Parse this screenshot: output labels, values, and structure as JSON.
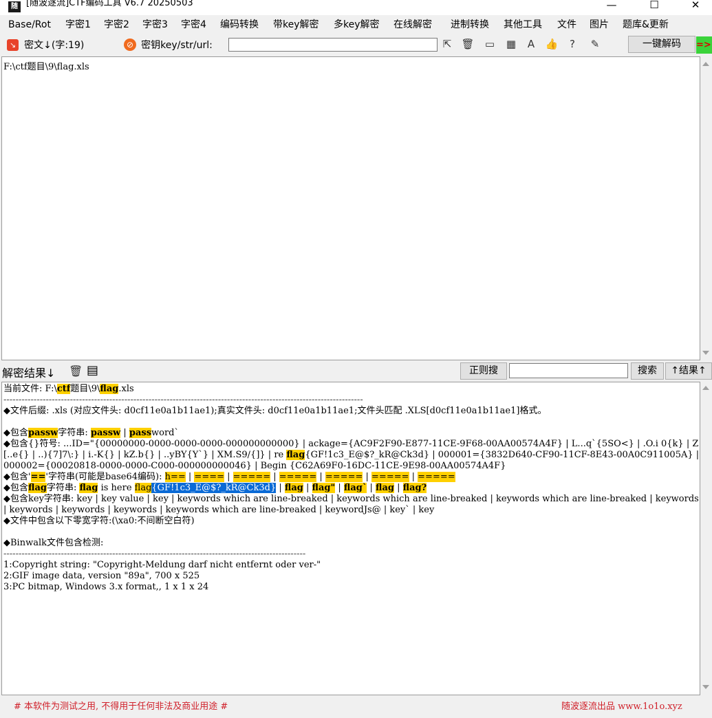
{
  "window": {
    "title": "[随波逐流]CTF编码工具 V6.7  20250503",
    "minimize": "—",
    "maximize": "☐",
    "close": "✕"
  },
  "menu": [
    "Base/Rot",
    "字密1",
    "字密2",
    "字密3",
    "字密4",
    "编码转换",
    "带key解密",
    "多key解密",
    "在线解密",
    "进制转换",
    "其他工具",
    "文件",
    "图片",
    "题库&更新"
  ],
  "toolbar": {
    "cipher_label": "密文↓(字:19)",
    "key_label": "密钥key/str/url:",
    "key_value": "",
    "one_click_label": "一键解码",
    "green_tab": "=>",
    "icons": [
      "cursor-icon",
      "trash-icon",
      "terminal-icon",
      "calculator-icon",
      "font-icon",
      "thumbs-up-icon",
      "help-icon",
      "edit-icon"
    ]
  },
  "cipher": {
    "text": "F:\\ctf题目\\9\\flag.xls"
  },
  "result_bar": {
    "label": "解密结果↓",
    "regex_button": "正则搜",
    "search_value": "",
    "search_button": "搜索",
    "result_up_button": "↑结果↑"
  },
  "result": {
    "file_prefix": "当前文件: F:\\",
    "file_ctf": "ctf",
    "file_mid": "题目\\9\\",
    "file_flag": "flag",
    "file_ext": ".xls",
    "separator": "-----------------------------------------------------------------------------------------------------------------------",
    "suffix_line": "◆文件后缀: .xls (对应文件头: d0cf11e0a1b11ae1);真实文件头: d0cf11e0a1b11ae1;文件头匹配 .XLS[d0cf11e0a1b11ae1]格式。",
    "passw_label_a": "◆包含",
    "passw_label_b": "passw",
    "passw_label_c": "字符串: ",
    "passw_v1a": "passw",
    "passw_sep": " | ",
    "passw_v2a": "pass",
    "passw_v2b": "word`",
    "brace_text_a": "◆包含{}符号: ...ID=\"{00000000-0000-0000-0000-000000000000} | ackage={AC9F2F90-E877-11CE-9F68-00AA00574A4F} | L...q`{5SO<} | .O.i 0{k} | Z[..e{} | ..){7]7\\:} | i.-K{} | kZ.b{} | ..yBY{Y`} | XM.S9/{]} | re ",
    "brace_flag": "flag",
    "brace_text_b": "{GF!1c3_E@$?_kR@Ck3d} | 000001={3832D640-CF90-11CF-8E43-00A0C911005A} | 000002={00020818-0000-0000-C000-000000000046} | Begin {C62A69F0-16DC-11CE-9E98-00AA00574A4F}",
    "eq_label": "◆包含'",
    "eq_mark": "==",
    "eq_label_b": "'字符串(可能是base64编码): ",
    "eq_items": [
      "h==",
      "====",
      "=====",
      "=====",
      "=====",
      "=====",
      "====="
    ],
    "flag_label_a": "◆包含",
    "flag_label_b": "flag",
    "flag_label_c": "字符串: ",
    "flag_v1": "flag",
    "flag_v1_rest": " is here ",
    "flag_sel_a": "flag",
    "flag_sel_b": "{GF!1c3_E@$?_kR@Ck3d}",
    "flag_items": [
      "flag",
      "flag\"",
      "flag`",
      "flag",
      "flag?"
    ],
    "key_text": "◆包含key字符串: key | key value | key | keywords which are line-breaked | keywords which are line-breaked | keywords which are line-breaked | keywords | keywords | keywords | keywords | keywords which are line-breaked | keywordJs@ | key` | key",
    "zero_width": "◆文件中包含以下零宽字符:(\\xa0:不间断空白符)",
    "binwalk_title": "◆Binwalk文件包含检测:",
    "binwalk_sep": "----------------------------------------------------------------------------------------------------",
    "binwalk": [
      "1:Copyright string: \"Copyright-Meldung darf nicht entfernt oder ver-\"",
      "2:GIF image data, version \"89a\", 700 x 525",
      "3:PC bitmap, Windows 3.x format,, 1 x 1 x 24"
    ]
  },
  "footer": {
    "left": "# 本软件为测试之用, 不得用于任何非法及商业用途 #",
    "right": "随波逐流出品 www.1o1o.xyz"
  }
}
